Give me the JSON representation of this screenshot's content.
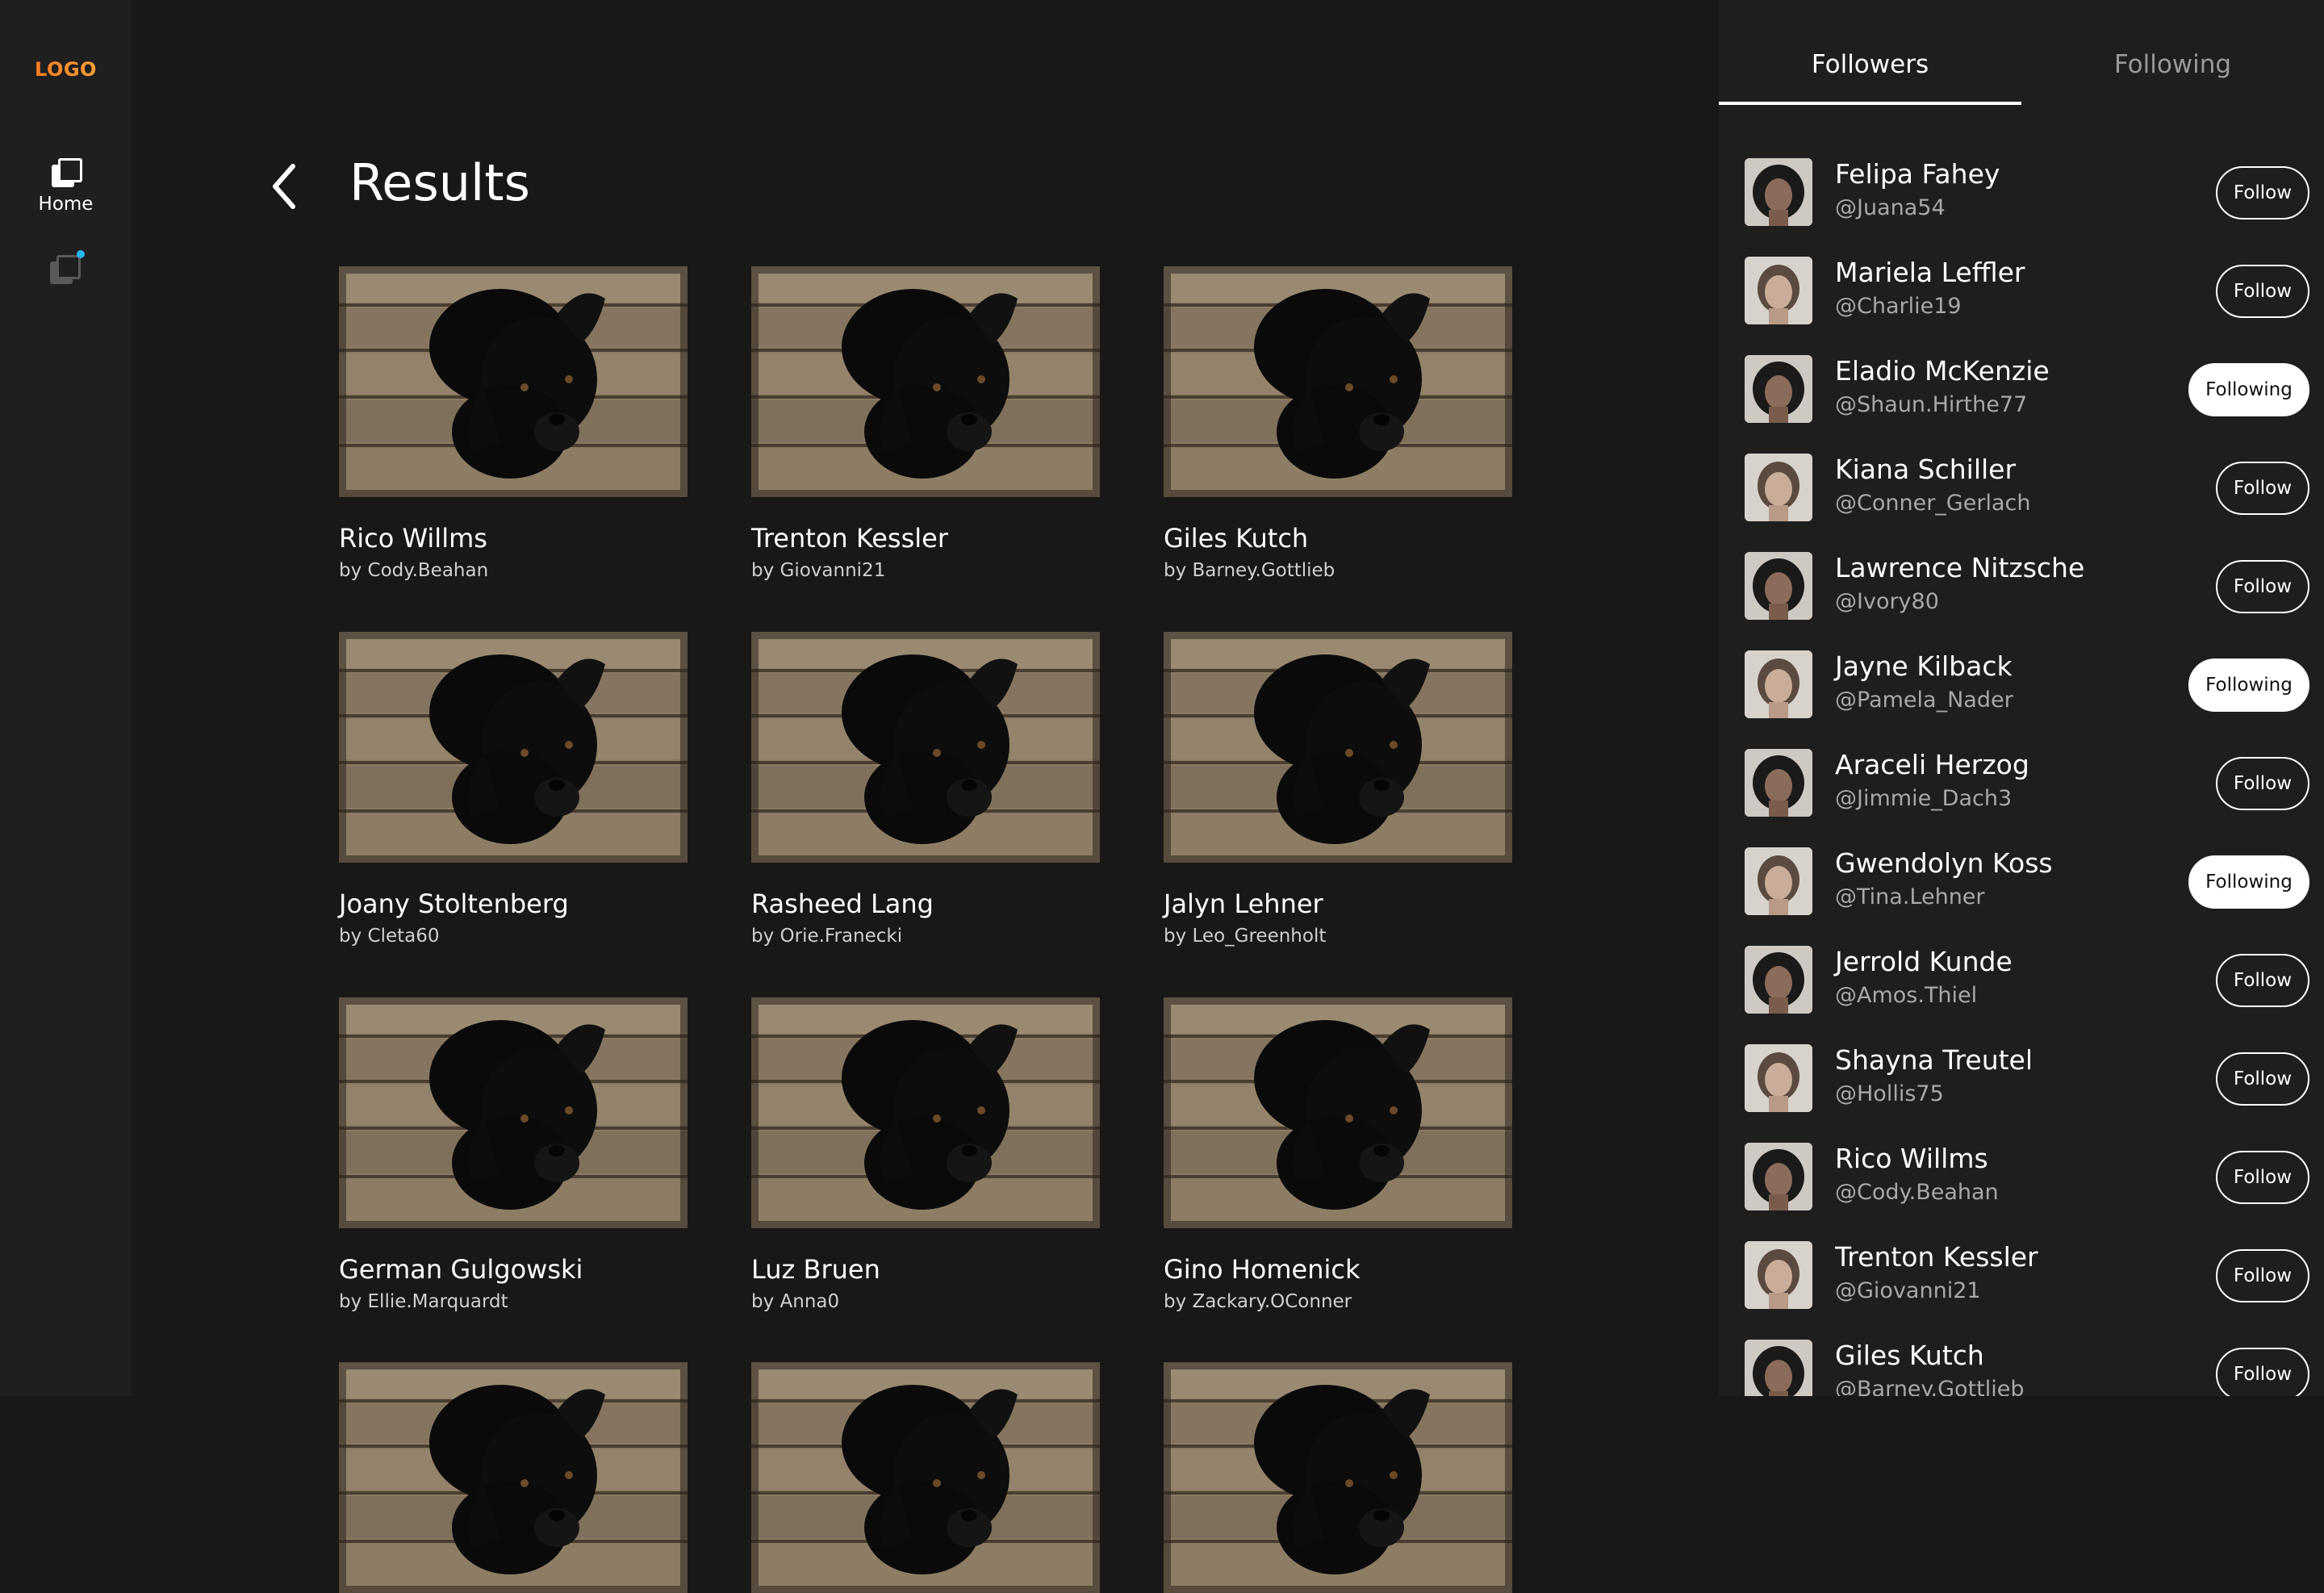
{
  "nav": {
    "logo": "LOGO",
    "home_label": "Home"
  },
  "main": {
    "title": "Results",
    "results": [
      {
        "name": "Rico Willms",
        "by": "by Cody.Beahan"
      },
      {
        "name": "Trenton Kessler",
        "by": "by Giovanni21"
      },
      {
        "name": "Giles Kutch",
        "by": "by Barney.Gottlieb"
      },
      {
        "name": "Joany Stoltenberg",
        "by": "by Cleta60"
      },
      {
        "name": "Rasheed Lang",
        "by": "by Orie.Franecki"
      },
      {
        "name": "Jalyn Lehner",
        "by": "by Leo_Greenholt"
      },
      {
        "name": "German Gulgowski",
        "by": "by Ellie.Marquardt"
      },
      {
        "name": "Luz Bruen",
        "by": "by Anna0"
      },
      {
        "name": "Gino Homenick",
        "by": "by Zackary.OConner"
      }
    ]
  },
  "panel": {
    "tabs": [
      {
        "label": "Followers"
      },
      {
        "label": "Following"
      }
    ],
    "users": [
      {
        "name": "Felipa Fahey",
        "handle": "@Juana54",
        "button": "Follow"
      },
      {
        "name": "Mariela Leffler",
        "handle": "@Charlie19",
        "button": "Follow"
      },
      {
        "name": "Eladio McKenzie",
        "handle": "@Shaun.Hirthe77",
        "button": "Following"
      },
      {
        "name": "Kiana Schiller",
        "handle": "@Conner_Gerlach",
        "button": "Follow"
      },
      {
        "name": "Lawrence Nitzsche",
        "handle": "@Ivory80",
        "button": "Follow"
      },
      {
        "name": "Jayne Kilback",
        "handle": "@Pamela_Nader",
        "button": "Following"
      },
      {
        "name": "Araceli Herzog",
        "handle": "@Jimmie_Dach3",
        "button": "Follow"
      },
      {
        "name": "Gwendolyn Koss",
        "handle": "@Tina.Lehner",
        "button": "Following"
      },
      {
        "name": "Jerrold Kunde",
        "handle": "@Amos.Thiel",
        "button": "Follow"
      },
      {
        "name": "Shayna Treutel",
        "handle": "@Hollis75",
        "button": "Follow"
      },
      {
        "name": "Rico Willms",
        "handle": "@Cody.Beahan",
        "button": "Follow"
      },
      {
        "name": "Trenton Kessler",
        "handle": "@Giovanni21",
        "button": "Follow"
      },
      {
        "name": "Giles Kutch",
        "handle": "@Barney.Gottlieb",
        "button": "Follow"
      }
    ]
  }
}
